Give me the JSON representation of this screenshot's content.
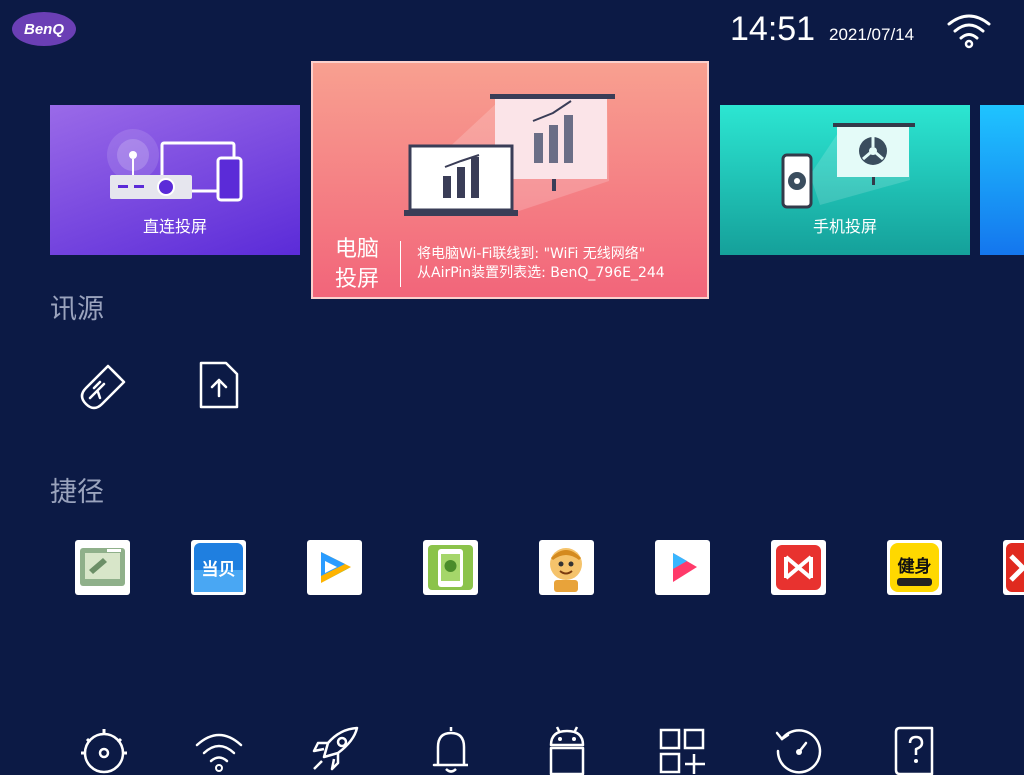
{
  "status_bar": {
    "brand": "BenQ",
    "time": "14:51",
    "date": "2021/07/14",
    "wifi_icon": "wifi-icon"
  },
  "cards": {
    "direct": {
      "label": "直连投屏",
      "icon": "projector-devices-icon"
    },
    "pc": {
      "title_line1": "电脑",
      "title_line2": "投屏",
      "desc_line1": "将电脑Wi-Fi联线到: \"WiFi 无线网络\"",
      "desc_line2": "从AirPin装置列表选: BenQ_796E_244",
      "icon": "laptop-presentation-icon"
    },
    "phone": {
      "label": "手机投屏",
      "icon": "phone-presentation-icon"
    }
  },
  "sources": {
    "title": "讯源",
    "items": [
      {
        "icon": "usb-drive-icon"
      },
      {
        "icon": "file-upload-icon"
      }
    ]
  },
  "shortcuts": {
    "title": "捷径",
    "apps": [
      {
        "icon": "screen-mirror-app-icon"
      },
      {
        "icon": "dangbei-app-icon",
        "text": "当贝"
      },
      {
        "icon": "tencent-video-app-icon"
      },
      {
        "icon": "android-mirror-app-icon"
      },
      {
        "icon": "monkey-king-app-icon"
      },
      {
        "icon": "video-play-app-icon"
      },
      {
        "icon": "wps-app-icon"
      },
      {
        "icon": "fitness-app-icon",
        "text": "健身"
      },
      {
        "icon": "red-app-icon"
      }
    ]
  },
  "bottom_bar": [
    {
      "icon": "settings-gear-icon"
    },
    {
      "icon": "wifi-icon"
    },
    {
      "icon": "rocket-icon"
    },
    {
      "icon": "bell-icon"
    },
    {
      "icon": "android-icon"
    },
    {
      "icon": "app-grid-icon"
    },
    {
      "icon": "update-icon"
    },
    {
      "icon": "help-book-icon"
    }
  ],
  "colors": {
    "background": "#0c1a45",
    "direct_card": "#7a4ae0",
    "pc_card": "#f4727f",
    "phone_card": "#1fc8b8",
    "partial_card": "#1a9cf8"
  }
}
